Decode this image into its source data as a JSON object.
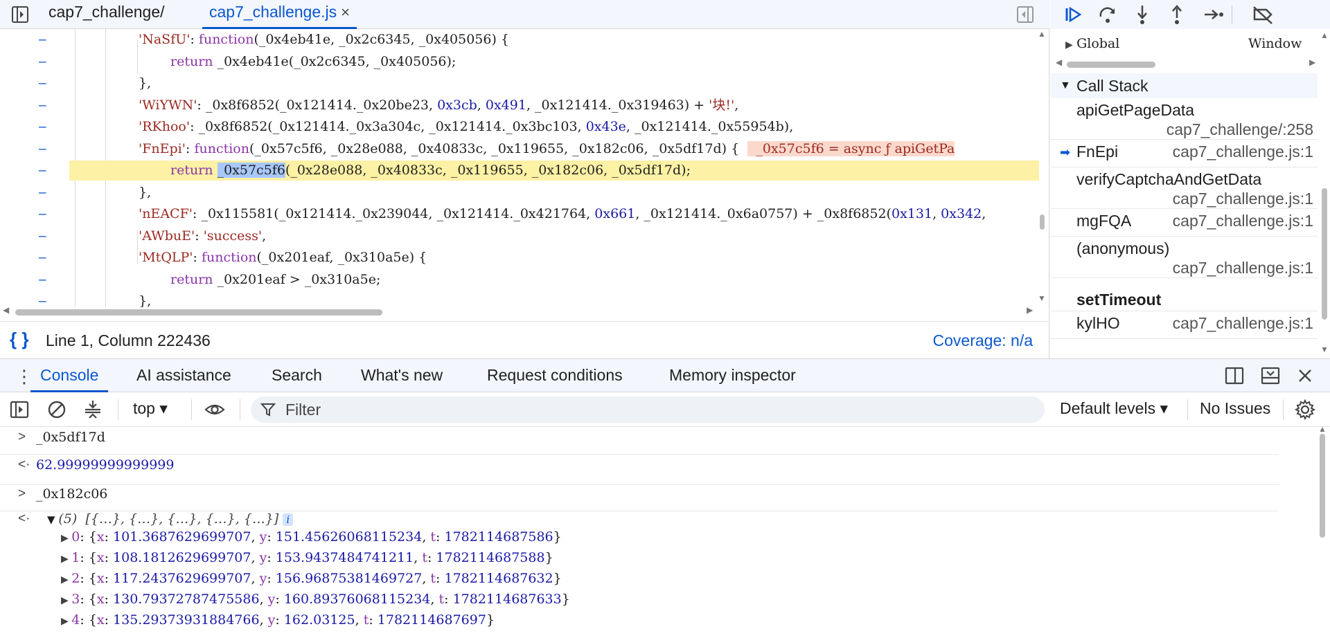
{
  "editor": {
    "tabs": [
      {
        "label": "cap7_challenge/",
        "closable": false
      },
      {
        "label": "cap7_challenge.js",
        "closable": true,
        "close": "×"
      }
    ],
    "lines": [
      {
        "gutter": "–",
        "text": "'NaSfU': function(_0x4eb41e, _0x2c6345, _0x405056) {"
      },
      {
        "gutter": "–",
        "text": "return _0x4eb41e(_0x2c6345, _0x405056);"
      },
      {
        "gutter": "–",
        "text": "},"
      },
      {
        "gutter": "–",
        "text": "'WiYWN': _0x8f6852(_0x121414._0x20be23, 0x3cb, 0x491, _0x121414._0x319463) + '块!',"
      },
      {
        "gutter": "–",
        "text": "'RKhoo': _0x8f6852(_0x121414._0x3a304c, _0x121414._0x3bc103, 0x43e, _0x121414._0x55954b),"
      },
      {
        "gutter": "–",
        "text": "'FnEpi': function(_0x57c5f6, _0x28e088, _0x40833c, _0x119655, _0x182c06, _0x5df17d) {"
      },
      {
        "gutter": "–",
        "text": "return _0x57c5f6(_0x28e088, _0x40833c, _0x119655, _0x182c06, _0x5df17d);"
      },
      {
        "gutter": "–",
        "text": "},"
      },
      {
        "gutter": "–",
        "text": "'nEACF': _0x115581(_0x121414._0x239044, _0x121414._0x421764, 0x661, _0x121414._0x6a0757) + _0x8f6852(0x131, 0x342,"
      },
      {
        "gutter": "–",
        "text": "'AWbuE': 'success',"
      },
      {
        "gutter": "–",
        "text": "'MtQLP': function(_0x201eaf, _0x310a5e) {"
      },
      {
        "gutter": "–",
        "text": "return _0x201eaf > _0x310a5e;"
      },
      {
        "gutter": "–",
        "text": "},"
      }
    ],
    "inline_value": "_0x57c5f6 = async ƒ apiGetPa",
    "selected_token": "_0x57c5f6",
    "status": {
      "position": "Line 1, Column 222436",
      "coverage": "Coverage: n/a",
      "brace": "{ }"
    }
  },
  "debugger": {
    "scope": {
      "label": "Global",
      "value": "Window"
    },
    "call_stack_title": "Call Stack",
    "frames": [
      {
        "fn": "apiGetPageData",
        "loc": "cap7_challenge/:258",
        "current": false
      },
      {
        "fn": "FnEpi",
        "loc": "cap7_challenge.js:1",
        "current": true
      },
      {
        "fn": "verifyCaptchaAndGetData",
        "loc": "cap7_challenge.js:1",
        "current": false
      },
      {
        "fn": "mgFQA",
        "loc": "cap7_challenge.js:1",
        "current": false
      },
      {
        "fn": "(anonymous)",
        "loc": "cap7_challenge.js:1",
        "current": false
      },
      {
        "fn": "setTimeout",
        "loc": "",
        "current": false,
        "async_marker": true
      },
      {
        "fn": "kylHO",
        "loc": "cap7_challenge.js:1",
        "current": false
      }
    ]
  },
  "drawer": {
    "tabs": [
      "Console",
      "AI assistance",
      "Search",
      "What's new",
      "Request conditions",
      "Memory inspector"
    ],
    "active_tab": "Console",
    "toolbar": {
      "context": "top ▾",
      "filter_placeholder": "Filter",
      "levels": "Default levels ▾",
      "issues": "No Issues"
    },
    "console": [
      {
        "type": "input",
        "prefix": ">",
        "text": "_0x5df17d"
      },
      {
        "type": "result",
        "prefix": "<·",
        "text": "62.99999999999999"
      },
      {
        "type": "input",
        "prefix": ">",
        "text": "_0x182c06"
      },
      {
        "type": "result-array",
        "prefix": "<·",
        "summary": "(5)",
        "preview": "[{…}, {…}, {…}, {…}, {…}]",
        "badge": "i",
        "items": [
          {
            "idx": "0",
            "x": "101.3687629699707",
            "y": "151.45626068115234",
            "t": "1782114687586"
          },
          {
            "idx": "1",
            "x": "108.1812629699707",
            "y": "153.9437484741211",
            "t": "1782114687588"
          },
          {
            "idx": "2",
            "x": "117.2437629699707",
            "y": "156.96875381469727",
            "t": "1782114687632"
          },
          {
            "idx": "3",
            "x": "130.79372787475586",
            "y": "160.89376068115234",
            "t": "1782114687633"
          },
          {
            "idx": "4",
            "x": "135.29373931884766",
            "y": "162.03125",
            "t": "1782114687697"
          }
        ]
      }
    ]
  }
}
